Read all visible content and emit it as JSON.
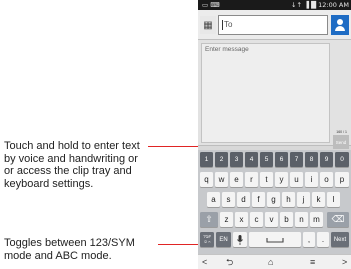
{
  "callouts": {
    "voice": {
      "lines": [
        "Touch and hold to enter text",
        "by voice and handwriting or",
        "or access the clip tray and",
        "keyboard settings."
      ]
    },
    "sym": {
      "lines": [
        "Toggles between 123/SYM",
        "mode and ABC mode."
      ]
    }
  },
  "status_bar": {
    "left": "▭ ⌨",
    "right": "↓↑ ▐ █ 12:00 AM"
  },
  "recipient": {
    "placeholder": "To",
    "contact_icon": "contact-card-icon",
    "person_icon": "person-icon"
  },
  "compose": {
    "placeholder": "Enter message",
    "counter": "160 / 1",
    "send_label": "Send",
    "attach_icon": "paperclip-icon"
  },
  "keyboard": {
    "number_row": [
      "1",
      "2",
      "3",
      "4",
      "5",
      "6",
      "7",
      "8",
      "9",
      "0"
    ],
    "row1": [
      "q",
      "w",
      "e",
      "r",
      "t",
      "y",
      "u",
      "i",
      "o",
      "p"
    ],
    "row2": [
      "a",
      "s",
      "d",
      "f",
      "g",
      "h",
      "j",
      "k",
      "l"
    ],
    "row3": [
      "z",
      "x",
      "c",
      "v",
      "b",
      "n",
      "m"
    ],
    "shift_icon": "shift-icon",
    "delete_icon": "backspace-icon",
    "sym_label_1": "?1#",
    "sym_label_2": "☺⌢",
    "lang_label": "EN",
    "mic_icon": "microphone-icon",
    "space_icon": "space-bar-icon",
    "comma_label": ",",
    "period_label": ".",
    "next_label": "Next"
  },
  "nav_bar": {
    "left": "<",
    "back": "⮌",
    "home": "⌂",
    "menu": "≡",
    "right": ">"
  }
}
